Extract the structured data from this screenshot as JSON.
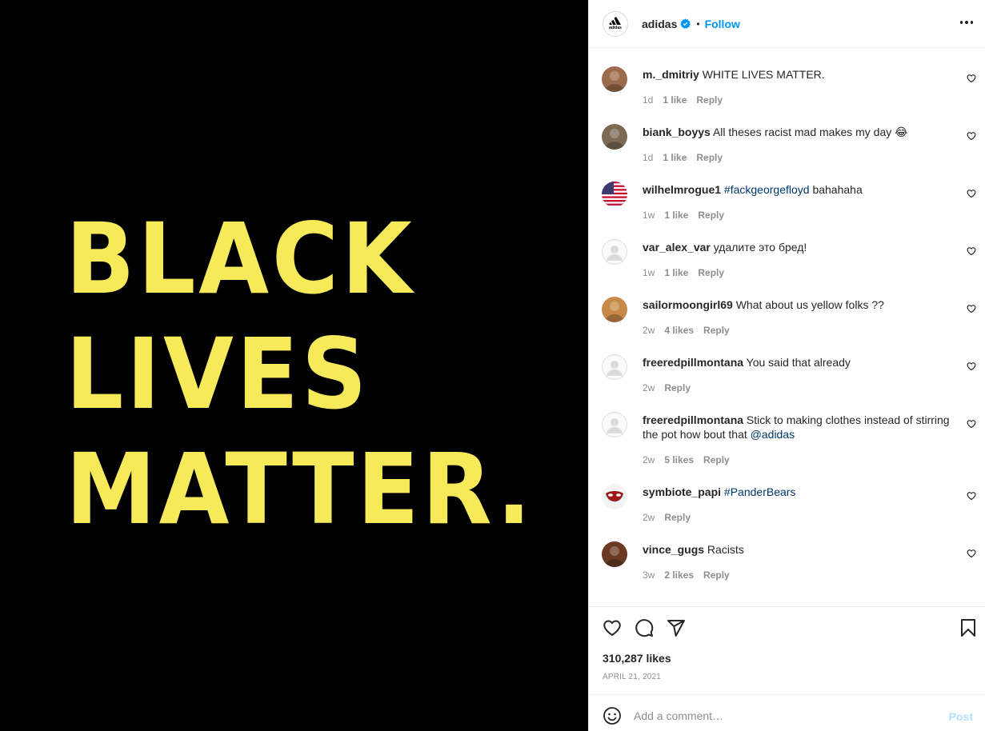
{
  "media": {
    "lines": [
      "BLACK",
      "LIVES",
      "MATTER."
    ],
    "background": "#000000",
    "text_color": "#f7ea5a"
  },
  "header": {
    "username": "adidas",
    "separator": "•",
    "follow_label": "Follow",
    "avatar_text": "adidas",
    "accent_color": "#0095f6"
  },
  "comments": [
    {
      "user": "m._dmitriy",
      "text": "WHITE LIVES MATTER.",
      "link": "",
      "text_after": "",
      "time": "1d",
      "likes": "1 like",
      "reply": "Reply",
      "avatar": "#9c6b4d"
    },
    {
      "user": "biank_boyys",
      "text": "All theses racist mad makes my day 😂",
      "link": "",
      "text_after": "",
      "time": "1d",
      "likes": "1 like",
      "reply": "Reply",
      "avatar": "#7d6a55"
    },
    {
      "user": "wilhelmrogue1",
      "text": "",
      "link": "#fackgeorgefloyd",
      "text_after": " bahahaha",
      "time": "1w",
      "likes": "1 like",
      "reply": "Reply",
      "avatar": "flag"
    },
    {
      "user": "var_alex_var",
      "text": "удалите это бред!",
      "link": "",
      "text_after": "",
      "time": "1w",
      "likes": "1 like",
      "reply": "Reply",
      "avatar": "default"
    },
    {
      "user": "sailormoongirl69",
      "text": "What about us yellow folks ??",
      "link": "",
      "text_after": "",
      "time": "2w",
      "likes": "4 likes",
      "reply": "Reply",
      "avatar": "#c88a4a"
    },
    {
      "user": "freeredpillmontana",
      "text": "You said that already",
      "link": "",
      "text_after": "",
      "time": "2w",
      "likes": "",
      "reply": "Reply",
      "avatar": "default"
    },
    {
      "user": "freeredpillmontana",
      "text": "Stick to making clothes instead of stirring the pot how bout that ",
      "link": "@adidas",
      "text_after": "",
      "time": "2w",
      "likes": "5 likes",
      "reply": "Reply",
      "avatar": "default"
    },
    {
      "user": "symbiote_papi",
      "text": "",
      "link": "#PanderBears",
      "text_after": "",
      "time": "2w",
      "likes": "",
      "reply": "Reply",
      "avatar": "mask"
    },
    {
      "user": "vince_gugs",
      "text": "Racists",
      "link": "",
      "text_after": "",
      "time": "3w",
      "likes": "2 likes",
      "reply": "Reply",
      "avatar": "#6b3a22"
    }
  ],
  "actions": {
    "likes_count": "310,287 likes",
    "date": "APRIL 21, 2021"
  },
  "composer": {
    "placeholder": "Add a comment…",
    "post_label": "Post"
  },
  "icons": {
    "like": "heart-icon",
    "comment": "comment-bubble-icon",
    "share": "paper-plane-icon",
    "save": "bookmark-icon",
    "emoji": "emoji-icon",
    "more": "more-options-icon",
    "verified": "verified-badge-icon"
  }
}
